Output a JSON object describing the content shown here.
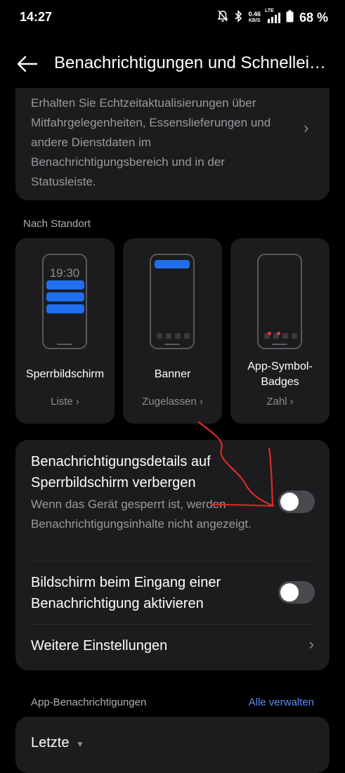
{
  "status_bar": {
    "time": "14:27",
    "net_speed_value": "0.46",
    "net_speed_unit": "KB/S",
    "network_type": "LTE",
    "battery": "68 %"
  },
  "header": {
    "title": "Benachrichtigungen und Schnellei…"
  },
  "top_card": {
    "description": "Erhalten Sie Echtzeitaktualisierungen über Mitfahrgelegenheiten, Essenslieferungen und andere Dienstdaten im Benachrichtigungsbereich und in der Statusleiste."
  },
  "location_section": {
    "label": "Nach Standort",
    "styles": [
      {
        "title": "Sperrbildschirm",
        "value": "Liste",
        "preview_clock": "19:30"
      },
      {
        "title": "Banner",
        "value": "Zugelassen"
      },
      {
        "title": "App-Symbol-Badges",
        "value": "Zahl"
      }
    ]
  },
  "settings": {
    "hide_details": {
      "title": "Benachrichtigungsdetails auf Sperrbildschirm verbergen",
      "description": "Wenn das Gerät gesperrt ist, werden Benachrichtigungsinhalte nicht angezeigt.",
      "enabled": false
    },
    "wake_screen": {
      "title": "Bildschirm beim Eingang einer Benachrichtigung aktivieren",
      "enabled": false
    },
    "more": {
      "title": "Weitere Einstellungen"
    }
  },
  "app_notifications": {
    "label": "App-Benachrichtigungen",
    "manage_all": "Alle verwalten",
    "filter": "Letzte"
  },
  "colors": {
    "accent": "#1f6ff0",
    "link": "#5b8cf5",
    "annotation": "#e0282a"
  }
}
